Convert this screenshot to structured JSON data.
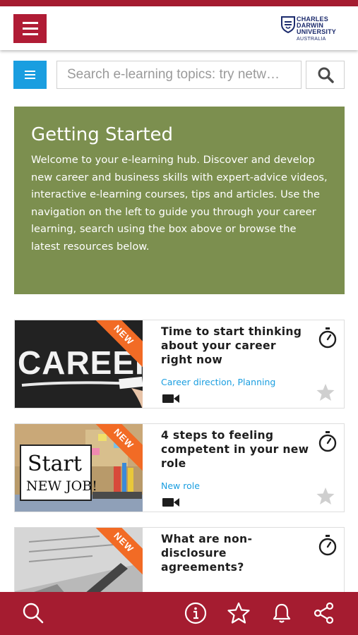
{
  "header": {
    "menu_icon": "hamburger-icon",
    "logo": {
      "line1": "CHARLES",
      "line2": "DARWIN",
      "line3": "UNIVERSITY",
      "sub": "AUSTRALIA"
    }
  },
  "search": {
    "filter_icon": "list-icon",
    "placeholder": "Search e-learning topics: try netw…",
    "value": "",
    "search_icon": "search-icon"
  },
  "hero": {
    "title": "Getting Started",
    "body": "Welcome to your e-learning hub. Discover and develop new career and business skills with expert-advice videos, interactive e-learning courses, tips and articles. Use the navigation on the left to guide you through your career learning, search using the box above or browse the latest resources below."
  },
  "cards": [
    {
      "badge": "NEW",
      "title": "Time to start thinking about your career right now",
      "tags": "Career direction, Planning",
      "image_text": "CAREER",
      "type_icon": "video-icon",
      "timer_icon": "stopwatch-icon",
      "star_icon": "star-icon"
    },
    {
      "badge": "NEW",
      "title": "4 steps to feeling competent in your new role",
      "tags": "New role",
      "image_text_1": "Start",
      "image_text_2": "NEW JOB!",
      "type_icon": "video-icon",
      "timer_icon": "stopwatch-icon",
      "star_icon": "star-icon"
    },
    {
      "badge": "NEW",
      "title": "What are non-disclosure agreements?",
      "timer_icon": "stopwatch-icon"
    }
  ],
  "colors": {
    "brand_red": "#a51c30",
    "accent_blue": "#1a9ee0",
    "hero_green": "#7c8f4f",
    "badge_orange": "#f26b25"
  },
  "bottom_bar": [
    "search-icon",
    "info-icon",
    "star-icon",
    "bell-icon",
    "share-icon"
  ]
}
